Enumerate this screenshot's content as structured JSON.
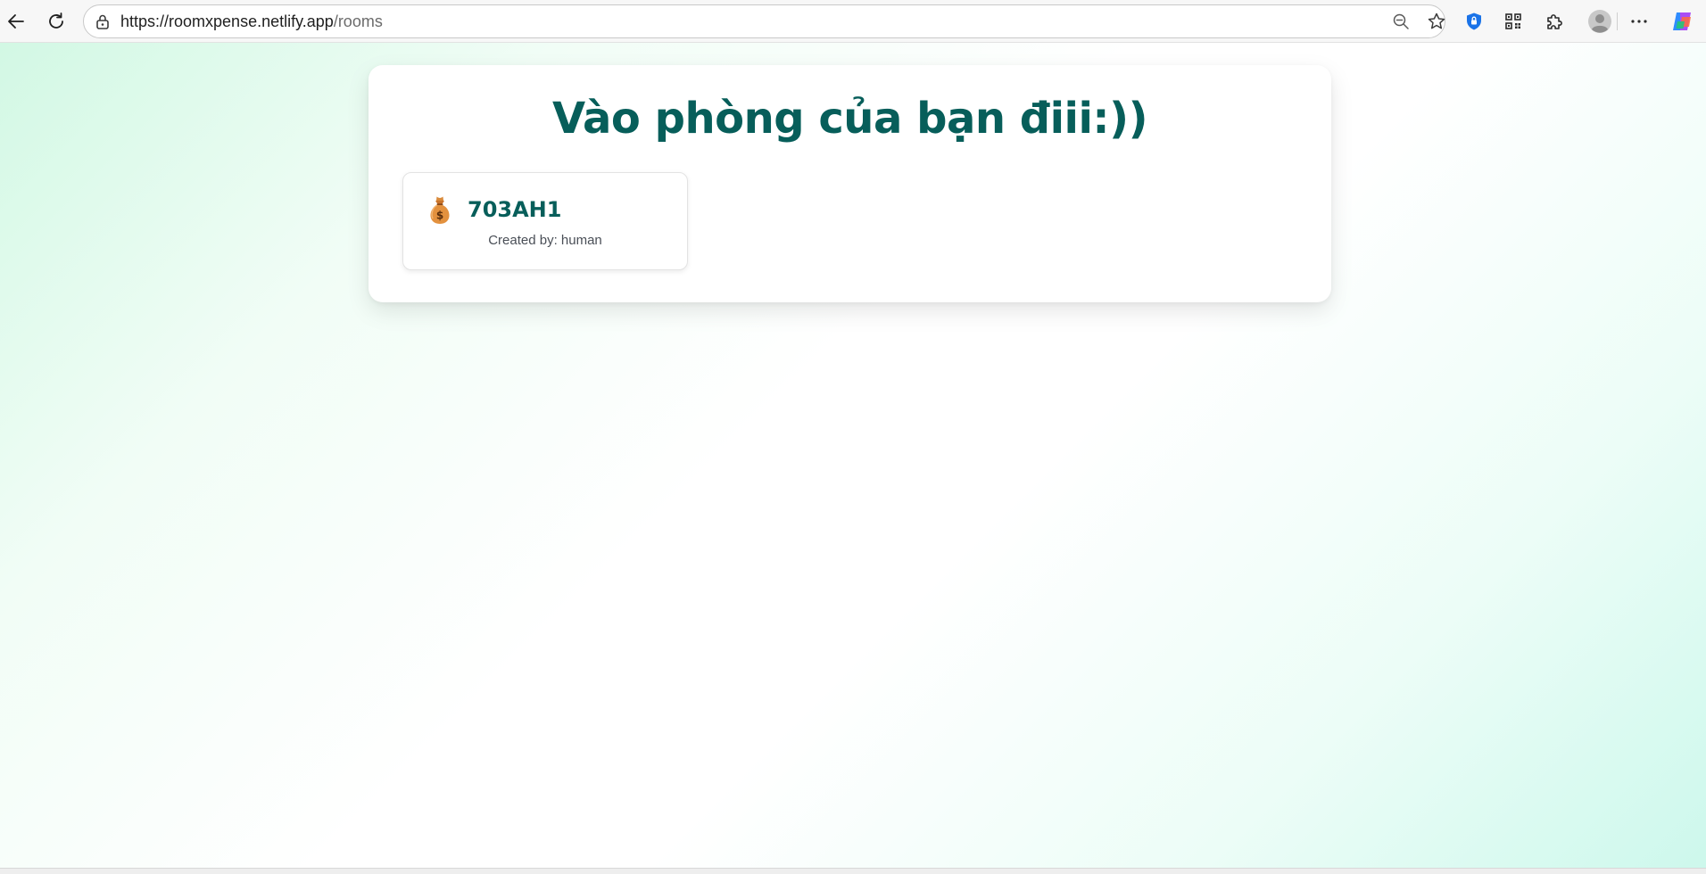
{
  "browser": {
    "url_host": "https://roomxpense.netlify.app",
    "url_path": "/rooms",
    "icons": {
      "back": "back-arrow-icon",
      "refresh": "refresh-icon",
      "site_info": "lock-icon",
      "zoom": "zoom-out-icon",
      "favorite": "star-icon",
      "shield": "shield-icon",
      "qr": "qr-code-icon",
      "extensions": "puzzle-icon",
      "profile": "avatar-icon",
      "more": "more-dots-icon",
      "copilot": "copilot-icon"
    }
  },
  "page": {
    "title": "Vào phòng của bạn điii:))",
    "title_color": "#075e5a",
    "rooms": [
      {
        "icon": "money-bag-icon",
        "name": "703AH1",
        "creator": "Created by: human"
      }
    ]
  }
}
